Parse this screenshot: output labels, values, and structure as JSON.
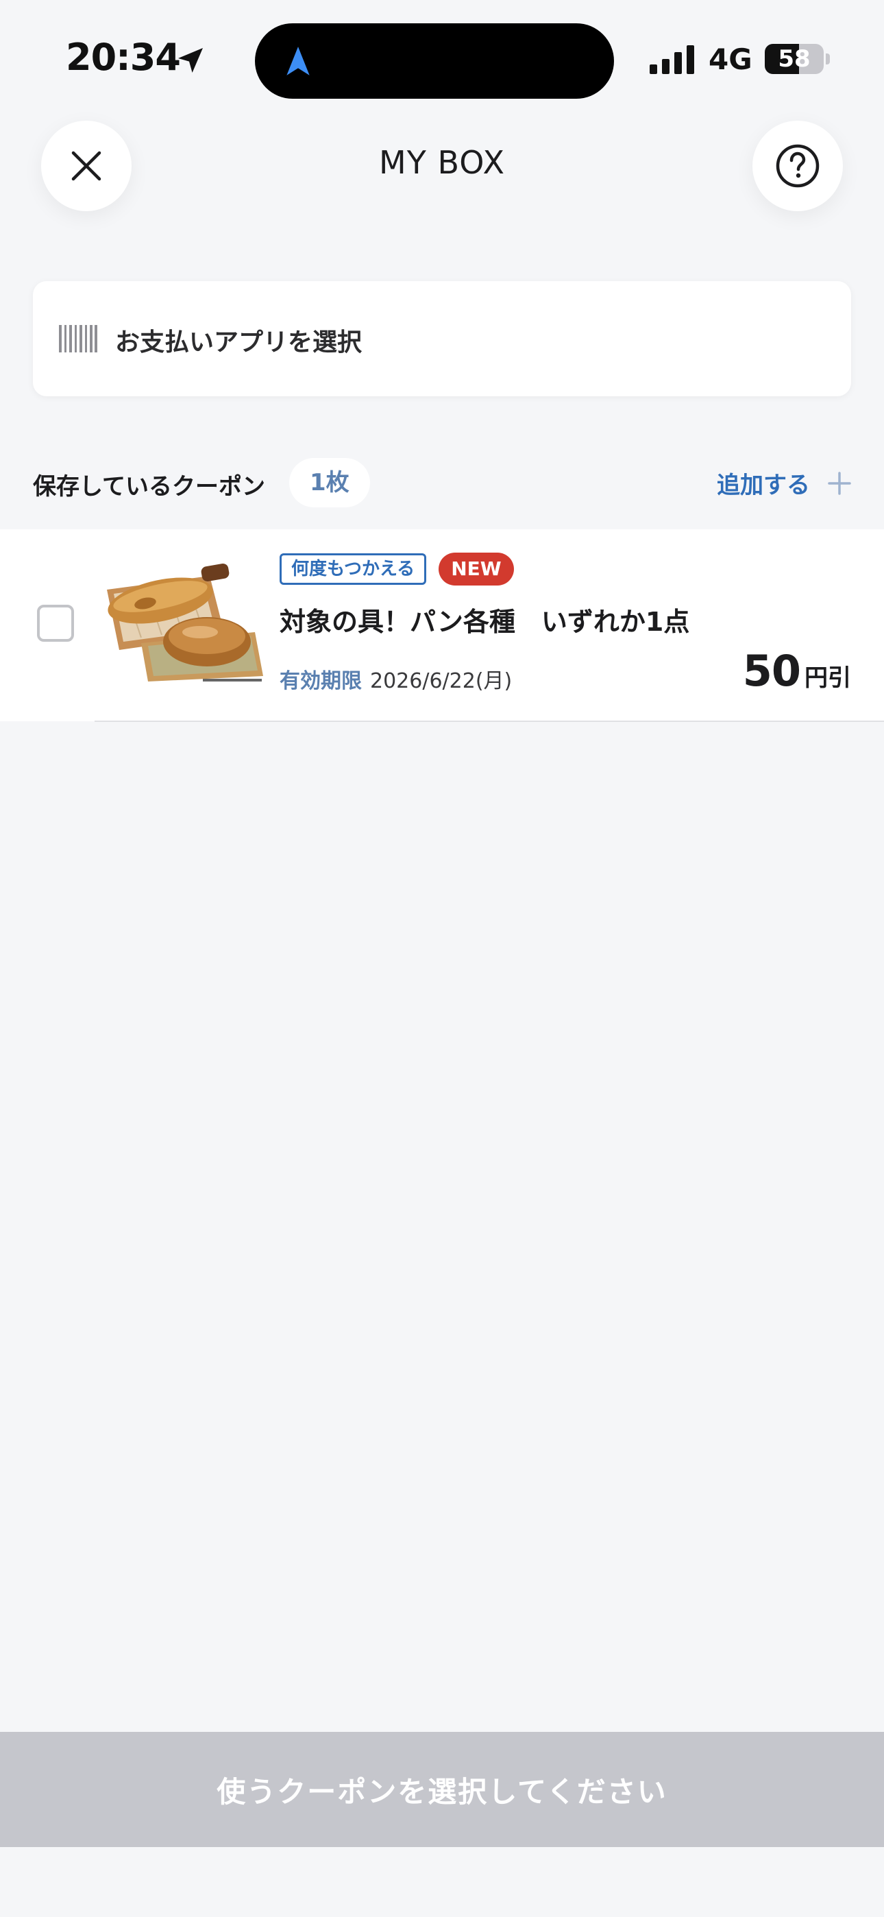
{
  "status_bar": {
    "time": "20:34",
    "network": "4G",
    "battery": "58",
    "battery_level_percent": 58
  },
  "header": {
    "title": "MY BOX",
    "icons": [
      "close-icon",
      "help-icon"
    ]
  },
  "payment": {
    "label": "お支払いアプリを選択",
    "icon": "barcode-icon"
  },
  "saved": {
    "label": "保存しているクーポン",
    "count": "1枚",
    "add_label": "追加する"
  },
  "coupons": [
    {
      "tag_reuse": "何度もつかえる",
      "tag_new": "NEW",
      "title": "対象の具！パン各種　いずれか1点",
      "expiry_label": "有効期限",
      "expiry_date": "2026/6/22(月)",
      "discount_value": "50",
      "discount_unit": "円引",
      "selected": false
    }
  ],
  "footer": {
    "use_button": "使うクーポンを選択してください"
  },
  "colors": {
    "accent_blue": "#2f6db8",
    "muted_blue": "#5a80b0",
    "new_red": "#d23a2e",
    "disabled_button": "#c5c6cc",
    "background": "#f5f6f8"
  }
}
